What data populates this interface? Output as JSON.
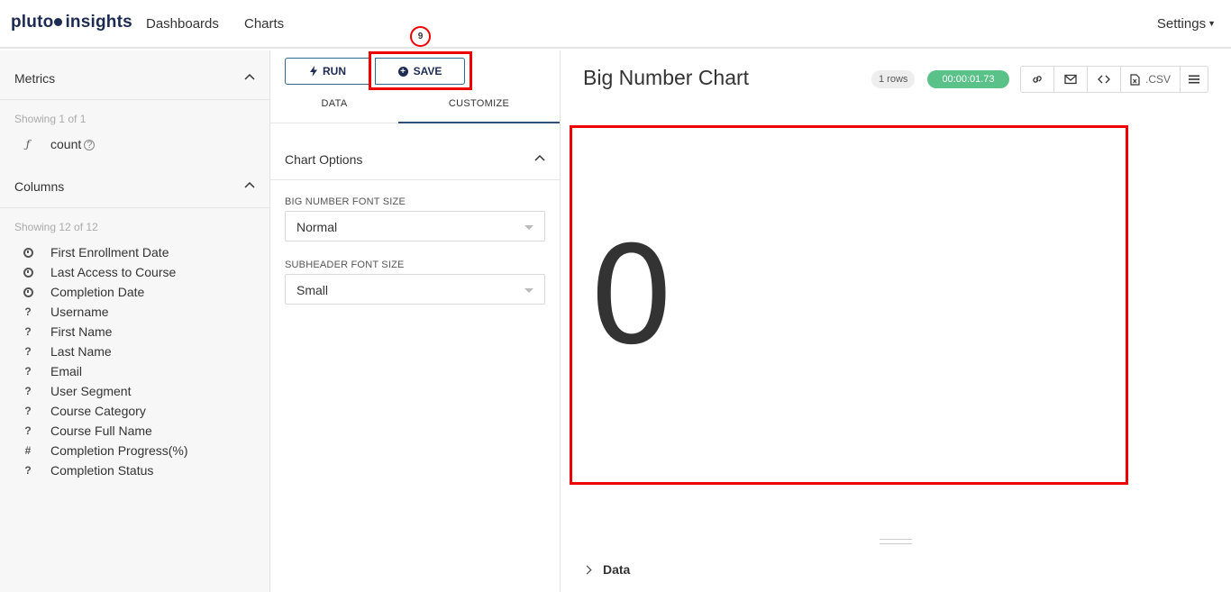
{
  "nav": {
    "logo_part1": "pluto",
    "logo_part2": "insights",
    "links": [
      "Dashboards",
      "Charts"
    ],
    "settings": "Settings"
  },
  "sidebar": {
    "metrics": {
      "title": "Metrics",
      "showing": "Showing 1 of 1",
      "items": [
        {
          "glyph": "ƒ",
          "label": "count"
        }
      ]
    },
    "columns": {
      "title": "Columns",
      "showing": "Showing 12 of 12",
      "items": [
        {
          "type": "clock",
          "label": "First Enrollment Date"
        },
        {
          "type": "clock",
          "label": "Last Access to Course"
        },
        {
          "type": "clock",
          "label": "Completion Date"
        },
        {
          "type": "?",
          "label": "Username"
        },
        {
          "type": "?",
          "label": "First Name"
        },
        {
          "type": "?",
          "label": "Last Name"
        },
        {
          "type": "?",
          "label": "Email"
        },
        {
          "type": "?",
          "label": "User Segment"
        },
        {
          "type": "?",
          "label": "Course Category"
        },
        {
          "type": "?",
          "label": "Course Full Name"
        },
        {
          "type": "#",
          "label": "Completion Progress(%)"
        },
        {
          "type": "?",
          "label": "Completion Status"
        }
      ]
    }
  },
  "panel": {
    "run_label": "RUN",
    "save_label": "SAVE",
    "tabs": [
      "DATA",
      "CUSTOMIZE"
    ],
    "active_tab": "CUSTOMIZE",
    "chart_options_title": "Chart Options",
    "big_number_font_size_label": "BIG NUMBER FONT SIZE",
    "big_number_font_size_value": "Normal",
    "subheader_font_size_label": "SUBHEADER FONT SIZE",
    "subheader_font_size_value": "Small"
  },
  "main": {
    "chart_title": "Big Number Chart",
    "rows_badge": "1 rows",
    "time_badge": "00:00:01.73",
    "toolbar": {
      "link_icon": "link-icon",
      "email_icon": "mail-icon",
      "embed_icon": "code-icon",
      "csv_label": ".CSV",
      "menu_icon": "hamburger-icon"
    },
    "big_number": "0",
    "data_section_label": "Data"
  },
  "annotation": {
    "step_number": "9"
  },
  "colors": {
    "brand": "#1d2b52",
    "highlight": "#e00000",
    "time_badge": "#5ac189",
    "button_border": "#2d6a8f"
  }
}
